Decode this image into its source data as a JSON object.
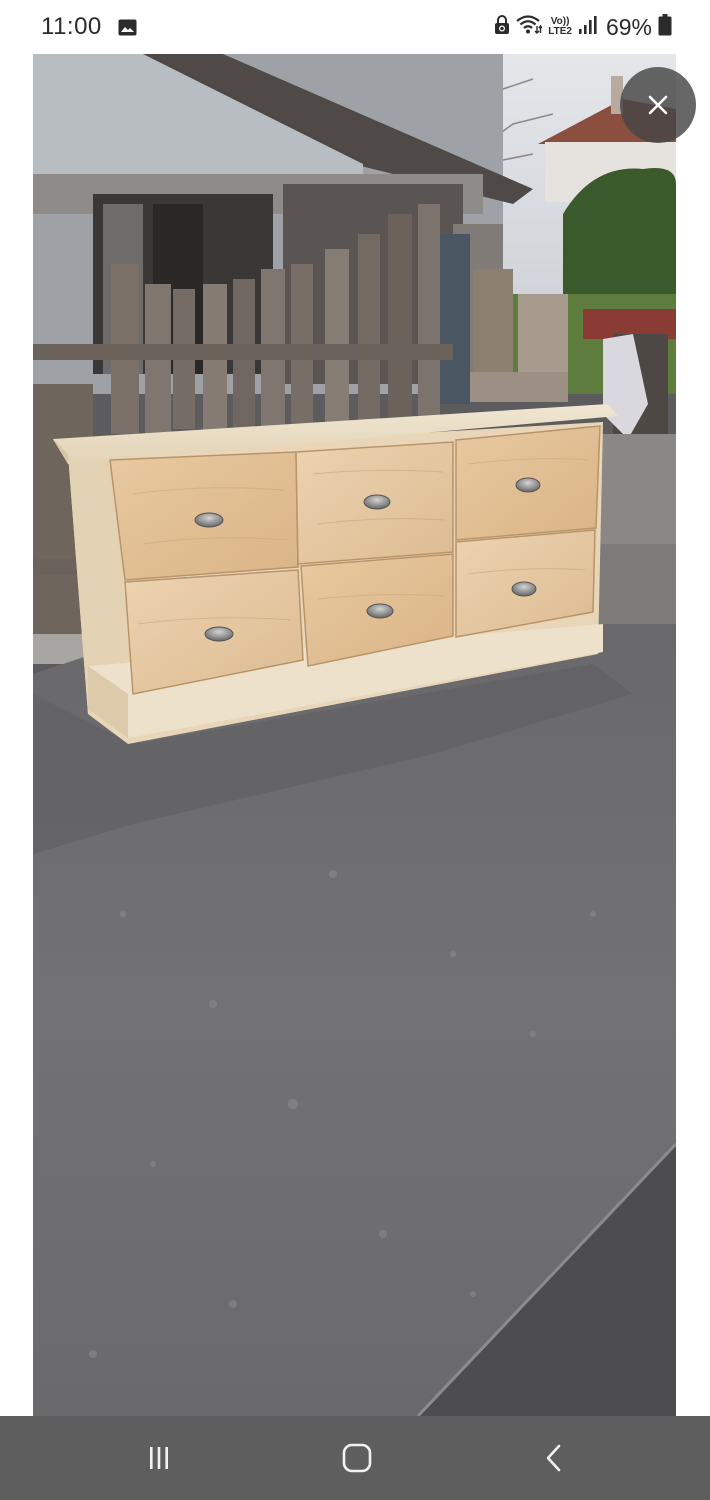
{
  "status_bar": {
    "time": "11:00",
    "network_line1": "Vo))",
    "network_line2": "LTE2",
    "battery": "69%",
    "icons": [
      "gallery-icon",
      "sync-lock-icon",
      "wifi-icon",
      "signal-icon",
      "battery-icon"
    ]
  },
  "viewer": {
    "close_icon": "close-icon",
    "photo_subject": "wooden-chest-of-drawers"
  },
  "nav_bar": {
    "icons": [
      "recents-icon",
      "home-icon",
      "back-icon"
    ]
  },
  "colors": {
    "status_bar_bg": "#ffffff",
    "nav_bar_bg": "#5e5e5e",
    "close_button_bg": "#464646"
  }
}
